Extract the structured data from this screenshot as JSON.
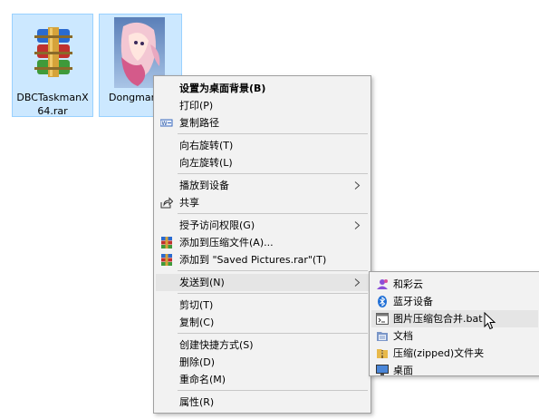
{
  "desktop": {
    "items": [
      {
        "label": "DBCTaskmanX64.rar",
        "icon": "winrar-archive-icon"
      },
      {
        "label": "Dongman",
        "icon": "anime-image-thumbnail"
      }
    ]
  },
  "context_menu": {
    "items": [
      {
        "label": "设置为桌面背景(B)",
        "bold": true
      },
      {
        "label": "打印(P)"
      },
      {
        "label": "复制路径",
        "icon": "copy-path-icon"
      },
      {
        "label": "向右旋转(T)"
      },
      {
        "label": "向左旋转(L)"
      },
      {
        "label": "播放到设备",
        "submenu": true
      },
      {
        "label": "共享",
        "icon": "share-icon"
      },
      {
        "label": "授予访问权限(G)",
        "submenu": true
      },
      {
        "label": "添加到压缩文件(A)...",
        "icon": "winrar-icon"
      },
      {
        "label": "添加到 \"Saved Pictures.rar\"(T)",
        "icon": "winrar-icon"
      },
      {
        "label": "发送到(N)",
        "submenu": true,
        "highlighted": true
      },
      {
        "label": "剪切(T)"
      },
      {
        "label": "复制(C)"
      },
      {
        "label": "创建快捷方式(S)"
      },
      {
        "label": "删除(D)"
      },
      {
        "label": "重命名(M)"
      },
      {
        "label": "属性(R)"
      }
    ]
  },
  "send_to_menu": {
    "items": [
      {
        "label": "和彩云",
        "icon": "hecaiyun-icon"
      },
      {
        "label": "蓝牙设备",
        "icon": "bluetooth-icon"
      },
      {
        "label": "图片压缩包合并.bat",
        "icon": "batch-file-icon",
        "highlighted": true
      },
      {
        "label": "文档",
        "icon": "documents-icon"
      },
      {
        "label": "压缩(zipped)文件夹",
        "icon": "zip-folder-icon"
      },
      {
        "label": "桌面",
        "icon": "desktop-icon"
      }
    ]
  },
  "colors": {
    "selection": "#cce8ff",
    "menu_bg": "#f2f2f2",
    "hover": "#e5e5e5"
  }
}
